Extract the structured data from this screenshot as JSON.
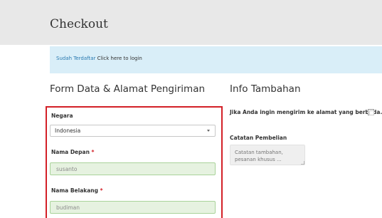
{
  "page": {
    "title": "Checkout"
  },
  "login_notice": {
    "prefix": "Sudah Terdaftar",
    "link": "Click here to login"
  },
  "billing": {
    "heading": "Form Data & Alamat Pengiriman",
    "country": {
      "label": "Negara",
      "selected": "Indonesia"
    },
    "first_name": {
      "label": "Nama Depan",
      "required_mark": "*",
      "value": "susanto"
    },
    "last_name": {
      "label": "Nama Belakang",
      "required_mark": "*",
      "value": "budiman"
    }
  },
  "additional_info": {
    "heading": "Info Tambahan",
    "ship_different_label": "Jika Anda ingin mengirim ke alamat yang berbeda.",
    "ship_different_checked": false,
    "order_notes": {
      "label": "Catatan Pembelian",
      "placeholder": "Catatan tambahan, pesanan khusus ..."
    }
  },
  "colors": {
    "header_background": "#e8e8e8",
    "notice_background": "#d9eef8",
    "highlight_border": "#d32027",
    "filled_field_background": "#e6f2e0",
    "filled_field_border": "#a9d39a"
  },
  "icons": {
    "select_caret": "chevron-down-icon",
    "textarea_resize": "resize-grip-icon"
  }
}
